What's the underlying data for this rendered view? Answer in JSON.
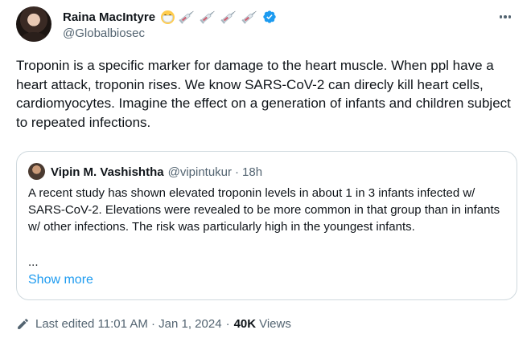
{
  "author": {
    "display_name": "Raina MacIntyre",
    "handle": "@Globalbiosec",
    "emoji": [
      "face-with-medical-mask",
      "syringe",
      "syringe",
      "syringe",
      "syringe"
    ],
    "verified_color": "#1d9bf0"
  },
  "tweet": {
    "text": "Troponin is a specific marker for damage to the heart muscle. When ppl have a heart attack, troponin rises. We know SARS-CoV-2 can direcly kill heart cells, cardiomyocytes. Imagine the effect on a generation of infants and children subject to repeated infections."
  },
  "quote": {
    "display_name": "Vipin M. Vashishtha",
    "handle": "@vipintukur",
    "separator": "·",
    "time": "18h",
    "text": "A recent study has shown elevated troponin levels in about 1 in 3 infants infected w/ SARS-CoV-2. Elevations were revealed to be more common in that group than in infants w/ other infections. The risk was particularly high in the youngest infants.",
    "ellipsis": "...",
    "show_more": "Show more"
  },
  "footer": {
    "edited": "Last edited 11:01 AM · Jan 1, 2024",
    "separator": "·",
    "views_count": "40K",
    "views_label": "Views"
  },
  "colors": {
    "text_primary": "#0f1419",
    "text_secondary": "#536471",
    "link": "#1d9bf0",
    "border": "#cfd9de"
  }
}
